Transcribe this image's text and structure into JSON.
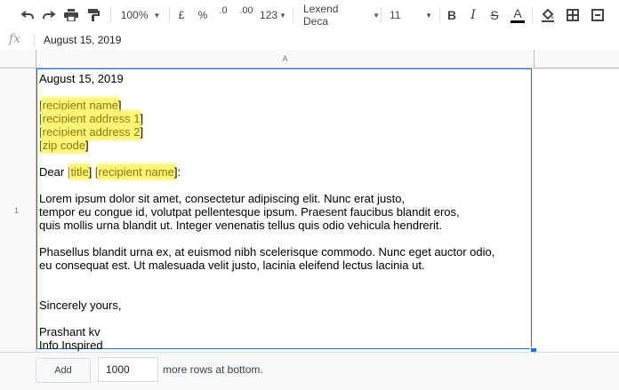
{
  "toolbar": {
    "zoom": "100%",
    "currency": "£",
    "percent": "%",
    "dec_decrease": ".0",
    "dec_increase": ".00",
    "more_formats": "123",
    "font": "Lexend Deca",
    "font_size": "11",
    "bold": "B",
    "italic": "I",
    "strike": "S",
    "text_color": "A",
    "icons": [
      "undo-icon",
      "redo-icon",
      "print-icon",
      "paint-format-icon",
      "bold-icon",
      "italic-icon",
      "strikethrough-icon",
      "text-color-icon",
      "fill-color-icon",
      "borders-icon",
      "merge-cells-icon"
    ]
  },
  "formula_bar": {
    "fx": "fx",
    "value": "August 15, 2019"
  },
  "grid": {
    "column_header": "A",
    "row_number": "1"
  },
  "cell": {
    "date": "August 15, 2019",
    "recipient_name": "recipient name",
    "recipient_address_1": "recipient address 1",
    "recipient_address_2": "recipient address 2",
    "zip_code": "zip code",
    "dear": "Dear",
    "title": "title",
    "para1_line1": "Lorem ipsum dolor sit amet, consectetur adipiscing elit. Nunc erat justo,",
    "para1_line2": "tempor eu congue id, volutpat pellentesque ipsum. Praesent faucibus blandit eros,",
    "para1_line3": "quis mollis urna blandit ut. Integer venenatis tellus quis odio vehicula hendrerit.",
    "para2_line1": "Phasellus blandit urna ex, at euismod nibh scelerisque commodo. Nunc eget auctor odio,",
    "para2_line2": "eu consequat est. Ut malesuada velit justo, lacinia eleifend lectus lacinia ut.",
    "closing": "Sincerely yours,",
    "sign_name": "Prashant kv",
    "sign_org": "Info Inspired",
    "highlight_color": "#fff475"
  },
  "footer": {
    "add_label": "Add",
    "rows_value": "1000",
    "more_rows_text": "more rows at bottom."
  }
}
